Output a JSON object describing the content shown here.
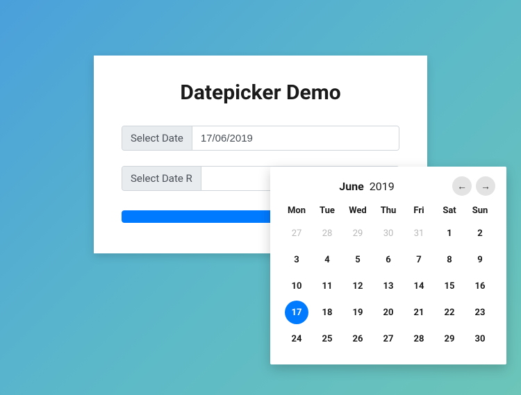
{
  "title": "Datepicker Demo",
  "inputs": {
    "date_label": "Select Date",
    "date_value": "17/06/2019",
    "range_label": "Select Date R",
    "range_value": ""
  },
  "submit_label": "",
  "calendar": {
    "month": "June",
    "year": "2019",
    "nav_prev": "←",
    "nav_next": "→",
    "day_headers": [
      "Mon",
      "Tue",
      "Wed",
      "Thu",
      "Fri",
      "Sat",
      "Sun"
    ],
    "cells": [
      {
        "d": "27",
        "muted": true
      },
      {
        "d": "28",
        "muted": true
      },
      {
        "d": "29",
        "muted": true
      },
      {
        "d": "30",
        "muted": true
      },
      {
        "d": "31",
        "muted": true
      },
      {
        "d": "1"
      },
      {
        "d": "2"
      },
      {
        "d": "3"
      },
      {
        "d": "4"
      },
      {
        "d": "5"
      },
      {
        "d": "6"
      },
      {
        "d": "7"
      },
      {
        "d": "8"
      },
      {
        "d": "9"
      },
      {
        "d": "10"
      },
      {
        "d": "11"
      },
      {
        "d": "12"
      },
      {
        "d": "13"
      },
      {
        "d": "14"
      },
      {
        "d": "15"
      },
      {
        "d": "16"
      },
      {
        "d": "17",
        "selected": true
      },
      {
        "d": "18"
      },
      {
        "d": "19"
      },
      {
        "d": "20"
      },
      {
        "d": "21"
      },
      {
        "d": "22"
      },
      {
        "d": "23"
      },
      {
        "d": "24"
      },
      {
        "d": "25"
      },
      {
        "d": "26"
      },
      {
        "d": "27"
      },
      {
        "d": "28"
      },
      {
        "d": "29"
      },
      {
        "d": "30"
      }
    ]
  }
}
